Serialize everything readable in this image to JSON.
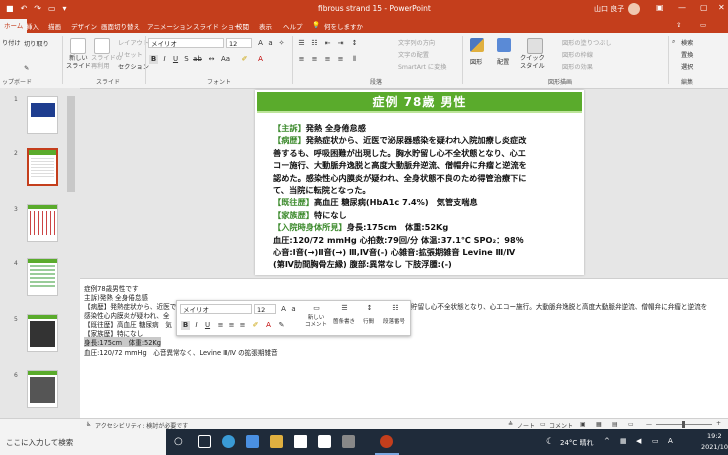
{
  "window": {
    "title": "fibrous strand 15  -  PowerPoint",
    "user": "山口 良子",
    "accent": "#c43e1c"
  },
  "ribbon_tabs": [
    "ファイル",
    "ホーム",
    "挿入",
    "描画",
    "デザイン",
    "画面切り替え",
    "アニメーション",
    "スライド ショー",
    "校閲",
    "表示",
    "ヘルプ",
    "何をしますか"
  ],
  "ribbon": {
    "paste_partial": "り付け",
    "clipboard_item1": "切り取り",
    "clipboard_label": "ップボード",
    "new_slide": "新しい\nスライド",
    "reuse_slide": "スライドの\n再利用",
    "layout": "レイアウト",
    "reset": "リセット",
    "section": "セクション",
    "slides_label": "スライド",
    "font_name": "メイリオ",
    "font_size": "12",
    "font_label": "フォント",
    "text_direction": "文字列の方向",
    "align_text": "文字の配置",
    "smartart": "SmartArt に変換",
    "paragraph_label": "段落",
    "shapes": "図形",
    "arrange": "配置",
    "quick_styles": "クイック\nスタイル",
    "shape_fill": "図形の塗りつぶし",
    "shape_outline": "図形の枠線",
    "shape_effects": "図形の効果",
    "drawing_label": "図形描画",
    "find": "検索",
    "replace": "置換",
    "select": "選択",
    "editing_label": "編集"
  },
  "slide": {
    "title": "症例  78歳  男性",
    "header_color": "#5aab2c",
    "line1_label": "【主訴】",
    "line1_text": "発熱 全身倦怠感",
    "line2_label": "【病歴】",
    "line2_text": "発熱症状から、近医で泌尿器感染を疑われ入院加療し炎症改",
    "line3": "善するも、呼吸困難が出現した。胸水貯留し心不全状態となり、心エ",
    "line4": "コー施行、大動脈弁逸脱と高度大動脈弁逆流、僧帽弁に弁瘤と逆流を",
    "line5": "認めた。感染性心内膜炎が疑われ、全身状態不良のため得管治療下に",
    "line6": "て、当院に転院となった。",
    "line7_label": "【既往歴】",
    "line7_text": "高血圧 糖尿病(HbA1c 7.4%)　気管支喘息",
    "line8_label": "【家族歴】",
    "line8_text": "特になし",
    "line9_label": "【入院時身体所見】",
    "line9_text": "身長:175cm　体重:52Kg",
    "line10": "血圧:120/72 mmHg 心拍数:79回/分 体温:37.1℃ SPO₂：98％",
    "line11": "心音:Ⅰ音(→)Ⅱ音(→) Ⅲ,Ⅳ音(-) 心雑音:拡張期雑音 Levine Ⅲ/Ⅳ",
    "line12": "(第Ⅳ肋間胸骨左縁) 腹部:異常なし 下肢浮腫:(-)"
  },
  "notes": {
    "lines": [
      "症例78歳男性です",
      "主訴)発熱 全身倦怠感",
      "【病歴】発熱症状から、近医で",
      "感染性心内膜炎が疑われ、全",
      "【既往歴】高血圧 糖尿病　気",
      "【家族歴】特になし",
      "身長:175cm　体重:52Kg",
      "血圧:120/72 mmHg　心音異常なく、Levine Ⅲ/Ⅳ の拡張期雑音"
    ],
    "continuation": "貯留し心不全状態となり、心エコー施行。大動脈弁逸脱と高度大動脈弁逆流、僧帽弁に弁瘤と逆流を"
  },
  "mini_toolbar": {
    "font": "メイリオ",
    "size": "12",
    "new_comment": "新しい\nコメント",
    "bullets": "箇条書き",
    "line_spacing": "行間",
    "numbering": "段落番号"
  },
  "status_bar": {
    "accessibility": "アクセシビリティ: 検討が必要です",
    "notes": "ノート",
    "comments": "コメント"
  },
  "taskbar": {
    "search_placeholder": "ここに入力して検索",
    "weather": "24°C 晴れ",
    "time": "19:2",
    "date": "2021/10"
  },
  "slide_numbers": [
    "1",
    "2",
    "3",
    "4",
    "5",
    "6"
  ]
}
